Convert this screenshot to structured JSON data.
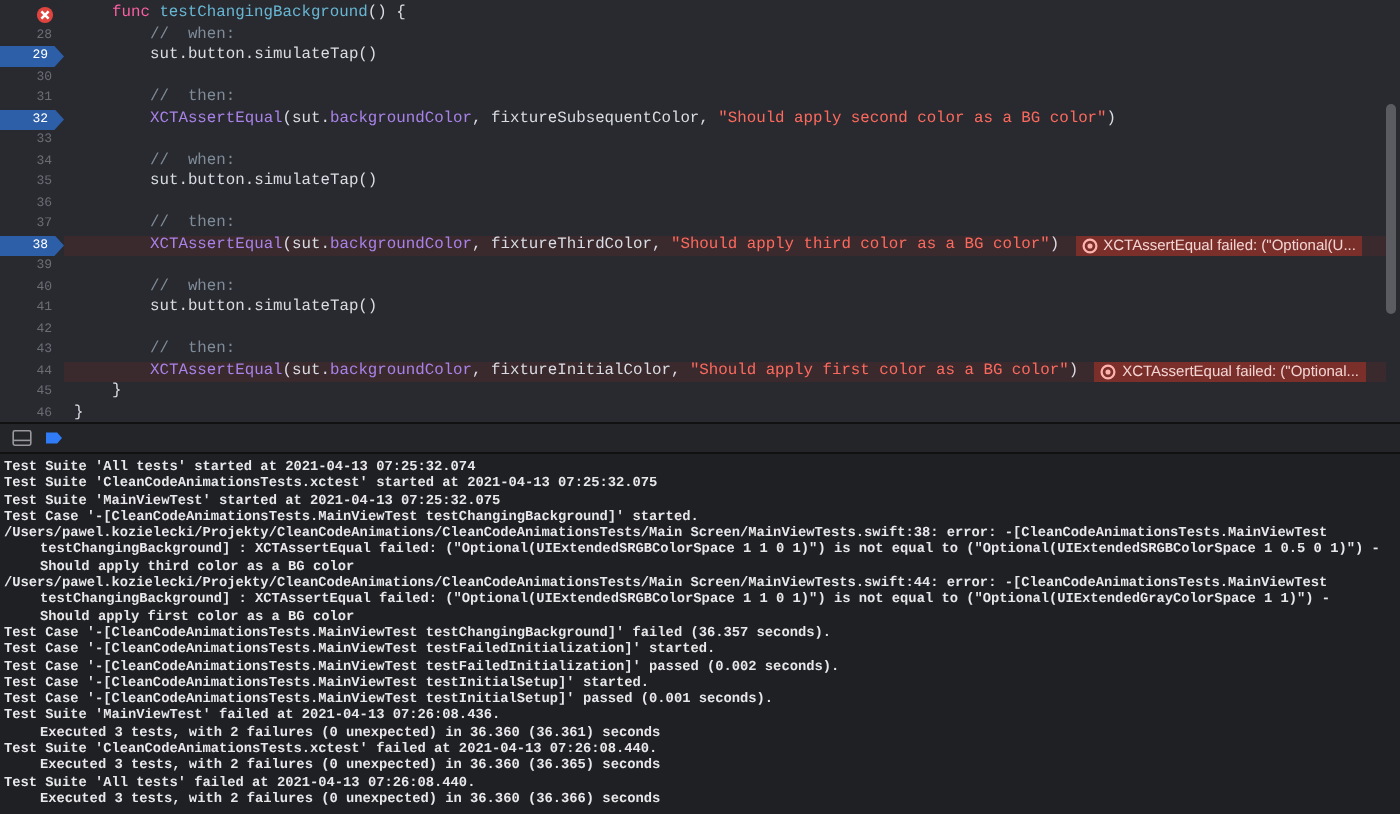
{
  "editor": {
    "lines": [
      {
        "error_marker": true,
        "kind": "member",
        "tokens": [
          {
            "kind": "keyword",
            "text": "func "
          },
          {
            "kind": "decl",
            "text": "testChangingBackground"
          },
          {
            "kind": "plain",
            "text": "() {"
          }
        ]
      },
      {
        "number": "28",
        "kind": "statement",
        "tokens": [
          {
            "kind": "comment",
            "text": "//  when:"
          }
        ]
      },
      {
        "number": "29",
        "breakpoint": true,
        "kind": "statement",
        "tokens": [
          {
            "kind": "plain",
            "text": "sut.button.simulateTap()"
          }
        ]
      },
      {
        "number": "30",
        "kind": "blank"
      },
      {
        "number": "31",
        "kind": "statement",
        "tokens": [
          {
            "kind": "comment",
            "text": "//  then:"
          }
        ]
      },
      {
        "number": "32",
        "breakpoint": true,
        "kind": "statement",
        "tokens": [
          {
            "kind": "call",
            "text": "XCTAssertEqual"
          },
          {
            "kind": "plain",
            "text": "(sut."
          },
          {
            "kind": "call",
            "text": "backgroundColor"
          },
          {
            "kind": "plain",
            "text": ", fixtureSubsequentColor, "
          },
          {
            "kind": "string",
            "text": "\"Should apply second color as a BG color\""
          },
          {
            "kind": "plain",
            "text": ")"
          }
        ]
      },
      {
        "number": "33",
        "kind": "blank"
      },
      {
        "number": "34",
        "kind": "statement",
        "tokens": [
          {
            "kind": "comment",
            "text": "//  when:"
          }
        ]
      },
      {
        "number": "35",
        "kind": "statement",
        "tokens": [
          {
            "kind": "plain",
            "text": "sut.button.simulateTap()"
          }
        ]
      },
      {
        "number": "36",
        "kind": "blank"
      },
      {
        "number": "37",
        "kind": "statement",
        "tokens": [
          {
            "kind": "comment",
            "text": "//  then:"
          }
        ]
      },
      {
        "number": "38",
        "breakpoint": true,
        "failed": true,
        "kind": "statement",
        "tokens": [
          {
            "kind": "call",
            "text": "XCTAssertEqual"
          },
          {
            "kind": "plain",
            "text": "(sut."
          },
          {
            "kind": "call",
            "text": "backgroundColor"
          },
          {
            "kind": "plain",
            "text": ", fixtureThirdColor, "
          },
          {
            "kind": "string",
            "text": "\"Should apply third color as a BG color\""
          },
          {
            "kind": "plain",
            "text": ")"
          }
        ],
        "error": "XCTAssertEqual failed: (\"Optional(U..."
      },
      {
        "number": "39",
        "kind": "blank"
      },
      {
        "number": "40",
        "kind": "statement",
        "tokens": [
          {
            "kind": "comment",
            "text": "//  when:"
          }
        ]
      },
      {
        "number": "41",
        "kind": "statement",
        "tokens": [
          {
            "kind": "plain",
            "text": "sut.button.simulateTap()"
          }
        ]
      },
      {
        "number": "42",
        "kind": "blank"
      },
      {
        "number": "43",
        "kind": "statement",
        "tokens": [
          {
            "kind": "comment",
            "text": "//  then:"
          }
        ]
      },
      {
        "number": "44",
        "failed": true,
        "kind": "statement",
        "tokens": [
          {
            "kind": "call",
            "text": "XCTAssertEqual"
          },
          {
            "kind": "plain",
            "text": "(sut."
          },
          {
            "kind": "call",
            "text": "backgroundColor"
          },
          {
            "kind": "plain",
            "text": ", fixtureInitialColor, "
          },
          {
            "kind": "string",
            "text": "\"Should apply first color as a BG color\""
          },
          {
            "kind": "plain",
            "text": ")"
          }
        ],
        "error": "XCTAssertEqual failed: (\"Optional..."
      },
      {
        "number": "45",
        "kind": "member",
        "tokens": [
          {
            "kind": "plain",
            "text": "}"
          }
        ]
      },
      {
        "number": "46",
        "kind": "top",
        "tokens": [
          {
            "kind": "plain",
            "text": "}"
          }
        ]
      }
    ]
  },
  "console": {
    "lines": [
      {
        "kind": "line",
        "text": "Test Suite 'All tests' started at 2021-04-13 07:25:32.074"
      },
      {
        "kind": "line",
        "text": "Test Suite 'CleanCodeAnimationsTests.xctest' started at 2021-04-13 07:25:32.075"
      },
      {
        "kind": "line",
        "text": "Test Suite 'MainViewTest' started at 2021-04-13 07:25:32.075"
      },
      {
        "kind": "line",
        "text": "Test Case '-[CleanCodeAnimationsTests.MainViewTest testChangingBackground]' started."
      },
      {
        "kind": "line",
        "text": "/Users/pawel.kozielecki/Projekty/CleanCodeAnimations/CleanCodeAnimationsTests/Main Screen/MainViewTests.swift:38: error: -[CleanCodeAnimationsTests.MainViewTest"
      },
      {
        "kind": "continuation",
        "text": "testChangingBackground] : XCTAssertEqual failed: (\"Optional(UIExtendedSRGBColorSpace 1 1 0 1)\") is not equal to (\"Optional(UIExtendedSRGBColorSpace 1 0.5 0 1)\") -"
      },
      {
        "kind": "continuation",
        "text": "Should apply third color as a BG color"
      },
      {
        "kind": "line",
        "text": "/Users/pawel.kozielecki/Projekty/CleanCodeAnimations/CleanCodeAnimationsTests/Main Screen/MainViewTests.swift:44: error: -[CleanCodeAnimationsTests.MainViewTest"
      },
      {
        "kind": "continuation",
        "text": "testChangingBackground] : XCTAssertEqual failed: (\"Optional(UIExtendedSRGBColorSpace 1 1 0 1)\") is not equal to (\"Optional(UIExtendedGrayColorSpace 1 1)\") -"
      },
      {
        "kind": "continuation",
        "text": "Should apply first color as a BG color"
      },
      {
        "kind": "line",
        "text": "Test Case '-[CleanCodeAnimationsTests.MainViewTest testChangingBackground]' failed (36.357 seconds)."
      },
      {
        "kind": "line",
        "text": "Test Case '-[CleanCodeAnimationsTests.MainViewTest testFailedInitialization]' started."
      },
      {
        "kind": "line",
        "text": "Test Case '-[CleanCodeAnimationsTests.MainViewTest testFailedInitialization]' passed (0.002 seconds)."
      },
      {
        "kind": "line",
        "text": "Test Case '-[CleanCodeAnimationsTests.MainViewTest testInitialSetup]' started."
      },
      {
        "kind": "line",
        "text": "Test Case '-[CleanCodeAnimationsTests.MainViewTest testInitialSetup]' passed (0.001 seconds)."
      },
      {
        "kind": "line",
        "text": "Test Suite 'MainViewTest' failed at 2021-04-13 07:26:08.436."
      },
      {
        "kind": "continuation",
        "text": "Executed 3 tests, with 2 failures (0 unexpected) in 36.360 (36.361) seconds"
      },
      {
        "kind": "line",
        "text": "Test Suite 'CleanCodeAnimationsTests.xctest' failed at 2021-04-13 07:26:08.440."
      },
      {
        "kind": "continuation",
        "text": "Executed 3 tests, with 2 failures (0 unexpected) in 36.360 (36.365) seconds"
      },
      {
        "kind": "line",
        "text": "Test Suite 'All tests' failed at 2021-04-13 07:26:08.440."
      },
      {
        "kind": "continuation",
        "text": "Executed 3 tests, with 2 failures (0 unexpected) in 36.360 (36.366) seconds"
      }
    ]
  }
}
